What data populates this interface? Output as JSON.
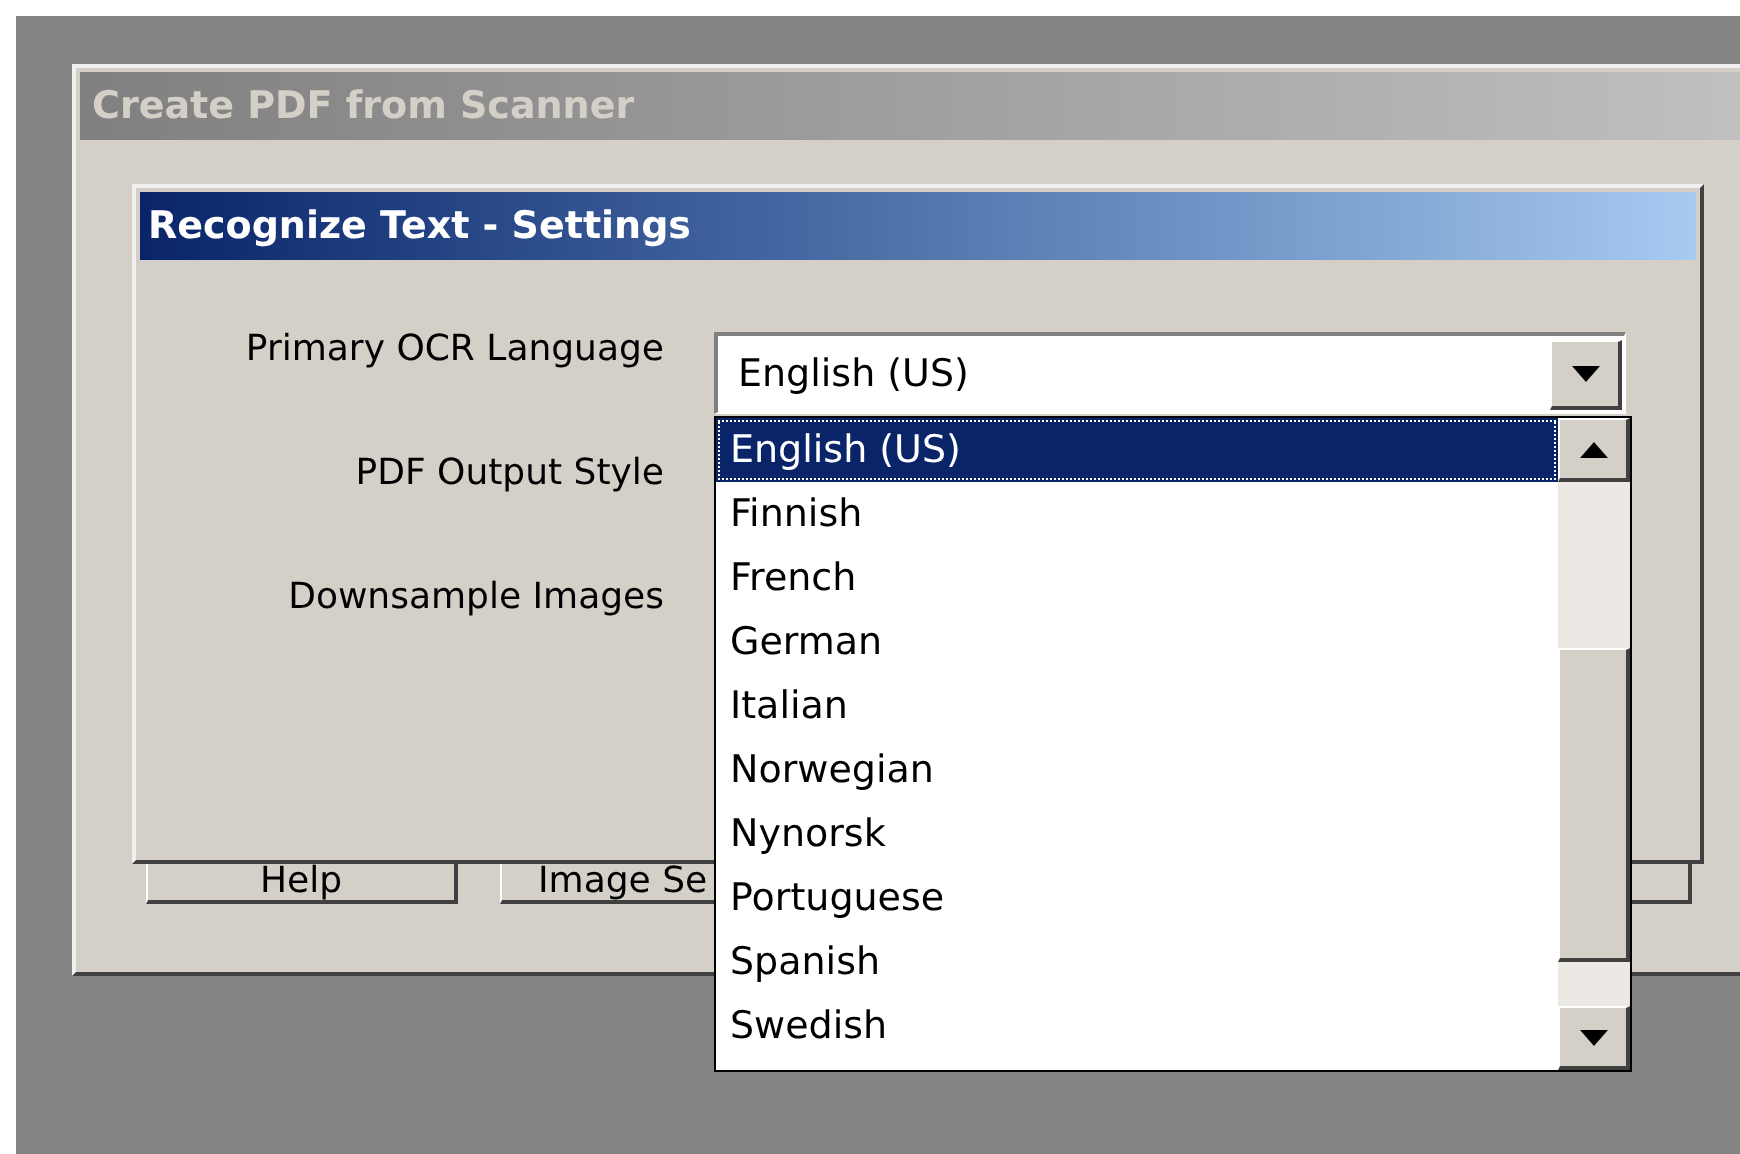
{
  "window": {
    "title": "Create PDF from Scanner"
  },
  "buttons": [
    {
      "label": "Help"
    },
    {
      "label": "Image Se"
    }
  ],
  "dialog": {
    "title": "Recognize Text - Settings",
    "fields": [
      {
        "label": "Primary OCR Language"
      },
      {
        "label": "PDF Output Style"
      },
      {
        "label": "Downsample Images"
      }
    ],
    "language_combo": {
      "value": "English (US)",
      "expanded": true,
      "options": [
        {
          "label": "English (US)",
          "selected": true
        },
        {
          "label": "Finnish",
          "selected": false
        },
        {
          "label": "French",
          "selected": false
        },
        {
          "label": "German",
          "selected": false
        },
        {
          "label": "Italian",
          "selected": false
        },
        {
          "label": "Norwegian",
          "selected": false
        },
        {
          "label": "Nynorsk",
          "selected": false
        },
        {
          "label": "Portuguese",
          "selected": false
        },
        {
          "label": "Spanish",
          "selected": false
        },
        {
          "label": "Swedish",
          "selected": false
        }
      ]
    }
  }
}
